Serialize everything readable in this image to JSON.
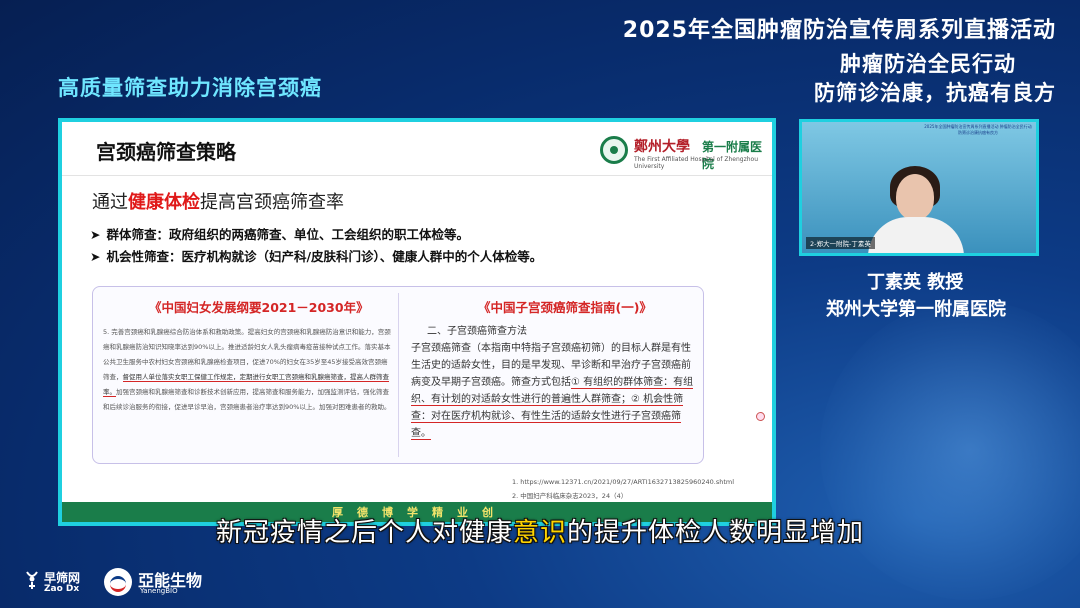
{
  "header": {
    "event_title": "2025年全国肿瘤防治宣传周系列直播活动",
    "slogan_line1": "肿瘤防治全民行动",
    "slogan_line2": "防筛诊治康，抗癌有良方",
    "topic": "高质量筛查助力消除宫颈癌"
  },
  "slide": {
    "title": "宫颈癌筛查策略",
    "hospital": {
      "university": "鄭州大學",
      "department": "第一附属医院",
      "english": "The First Affiliated Hospital of Zhengzhou University"
    },
    "headline_pre": "通过",
    "headline_highlight": "健康体检",
    "headline_post": "提高宫颈癌筛查率",
    "bullets": [
      "群体筛查：政府组织的两癌筛查、单位、工会组织的职工体检等。",
      "机会性筛查：医疗机构就诊（妇产科/皮肤科门诊）、健康人群中的个人体检等。"
    ],
    "ref_left_title": "《中国妇女发展纲要2021－2030年》",
    "ref_left_text_a": "5. 完善宫颈癌和乳腺癌综合防治体系和救助政策。提高妇女的宫颈癌和乳腺癌防治意识和能力，宫颈癌和乳腺癌防治知识知晓率达到90%以上。推进适龄妇女人乳头瘤病毒疫苗接种试点工作。落实基本公共卫生服务中农村妇女宫颈癌和乳腺癌检查项目，促进70%的妇女在35岁至45岁接受高效宫颈癌筛查，",
    "ref_left_text_u": "督促用人单位落实女职工保健工作规定，定期进行女职工宫颈癌和乳腺癌筛查，提高人群筛查率。",
    "ref_left_text_b": "加强宫颈癌和乳腺癌筛查和诊断技术创新应用，提高筛查和服务能力，加强监测评估，强化筛查和后续诊治服务的衔接，促进早诊早治，宫颈癌患者治疗率达到90%以上。加强对困难患者的救助。",
    "ref_right_title": "《中国子宫颈癌筛查指南(一)》",
    "ref_right_heading": "二、子宫颈癌筛查方法",
    "ref_right_text_a": "子宫颈癌筛查（本指南中特指子宫颈癌初筛）的目标人群是有性生活史的适龄女性，目的是早发现、早诊断和早治疗子宫颈癌前病变及早期子宫颈癌。筛查方式包括",
    "ref_right_text_u": "① 有组织的群体筛查：有组织、有计划的对适龄女性进行的普遍性人群筛查；② 机会性筛查：对在医疗机构就诊、有性生活的适龄女性进行子宫颈癌筛查。",
    "footnote1": "1.   https://www.12371.cn/2021/09/27/ARTI1632713825960240.shtml",
    "footnote2": "2.   中国妇产科临床杂志2023，24（4）",
    "motto": "厚德博学精业创"
  },
  "speaker": {
    "video_banner": "2025年全国肿瘤防治宣传周系列直播活动 肿瘤防治全民行动 防筛诊治康抗癌有良方",
    "video_label": "2-郑大一附院-丁素英",
    "name": "丁素英 教授",
    "affiliation": "郑州大学第一附属医院"
  },
  "caption": {
    "pre": "新冠疫情之后个人对健康",
    "keyword": "意识",
    "post": "的提升体检人数明显增加"
  },
  "logos": {
    "zaoshai_cn": "早筛网",
    "zaoshai_en": "Zao Dx",
    "yaneng_cn": "亞能生物",
    "yaneng_en": "YanengBIO"
  },
  "colors": {
    "topic_cyan": "#6fe6ff",
    "slide_border": "#1fd0e0",
    "highlight_red": "#e01919",
    "caption_keyword": "#ffd400"
  }
}
